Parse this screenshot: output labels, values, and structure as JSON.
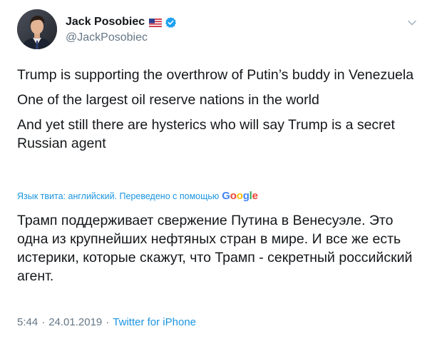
{
  "author": {
    "display_name": "Jack Posobiec",
    "handle": "@JackPosobiec",
    "flag_icon": "us-flag-icon",
    "verified_icon": "verified-badge-icon"
  },
  "menu": {
    "icon": "chevron-down-icon"
  },
  "tweet": {
    "paragraphs": [
      "Trump is supporting the overthrow of Putin’s buddy in Venezuela",
      "One of the largest oil reserve nations in the world",
      "And yet still there are hysterics who will say Trump is a secret Russian agent"
    ]
  },
  "translation": {
    "label": "Язык твита: английский. Переведено с помощью",
    "provider": "Google",
    "text": "Трамп поддерживает свержение Путина в Венесуэле. Это одна из крупнейших нефтяных стран в мире. И все же есть истерики, которые скажут, что Трамп - секретный российский агент."
  },
  "footer": {
    "time": "5:44",
    "date": "24.01.2019",
    "separator": "·",
    "source": "Twitter for iPhone"
  },
  "colors": {
    "link": "#1b95e0",
    "muted": "#657786",
    "text": "#14171a",
    "verified": "#1da1f2"
  }
}
